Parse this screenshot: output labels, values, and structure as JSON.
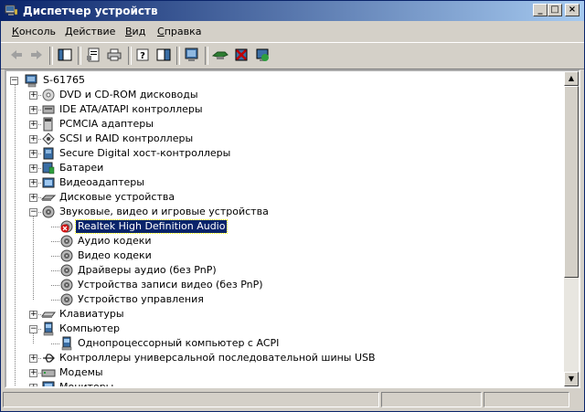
{
  "window": {
    "title": "Диспетчер устройств"
  },
  "title_buttons": {
    "minimize": "_",
    "maximize": "□",
    "close": "×"
  },
  "menu": [
    {
      "label": "Консоль",
      "accel": "К"
    },
    {
      "label": "Действие",
      "accel": "Д"
    },
    {
      "label": "Вид",
      "accel": "В"
    },
    {
      "label": "Справка",
      "accel": "С"
    }
  ],
  "toolbar": {
    "icons": [
      "back-arrow-icon",
      "forward-arrow-icon",
      "show-hide-tree-icon",
      "properties-icon",
      "print-icon",
      "help-icon",
      "view-icon",
      "scan-hardware-icon",
      "update-driver-icon",
      "uninstall-icon",
      "enable-device-icon"
    ]
  },
  "tree": {
    "root": "S-61765",
    "categories": [
      "DVD и CD-ROM дисководы",
      "IDE ATA/ATAPI контроллеры",
      "PCMCIA адаптеры",
      "SCSI и RAID контроллеры",
      "Secure Digital хост-контроллеры",
      "Батареи",
      "Видеоадаптеры",
      "Дисковые устройства",
      "Звуковые, видео и игровые устройства"
    ],
    "sound_children": [
      "Realtek High Definition Audio",
      "Аудио кодеки",
      "Видео кодеки",
      "Драйверы аудио (без PnP)",
      "Устройства записи видео (без PnP)",
      "Устройство управления"
    ],
    "after_sound": [
      "Клавиатуры",
      "Компьютер"
    ],
    "computer_children": [
      "Однопроцессорный компьютер с ACPI"
    ],
    "after_computer": [
      "Контроллеры универсальной последовательной шины USB",
      "Модемы",
      "Мониторы"
    ],
    "selected": "Realtek High Definition Audio"
  }
}
